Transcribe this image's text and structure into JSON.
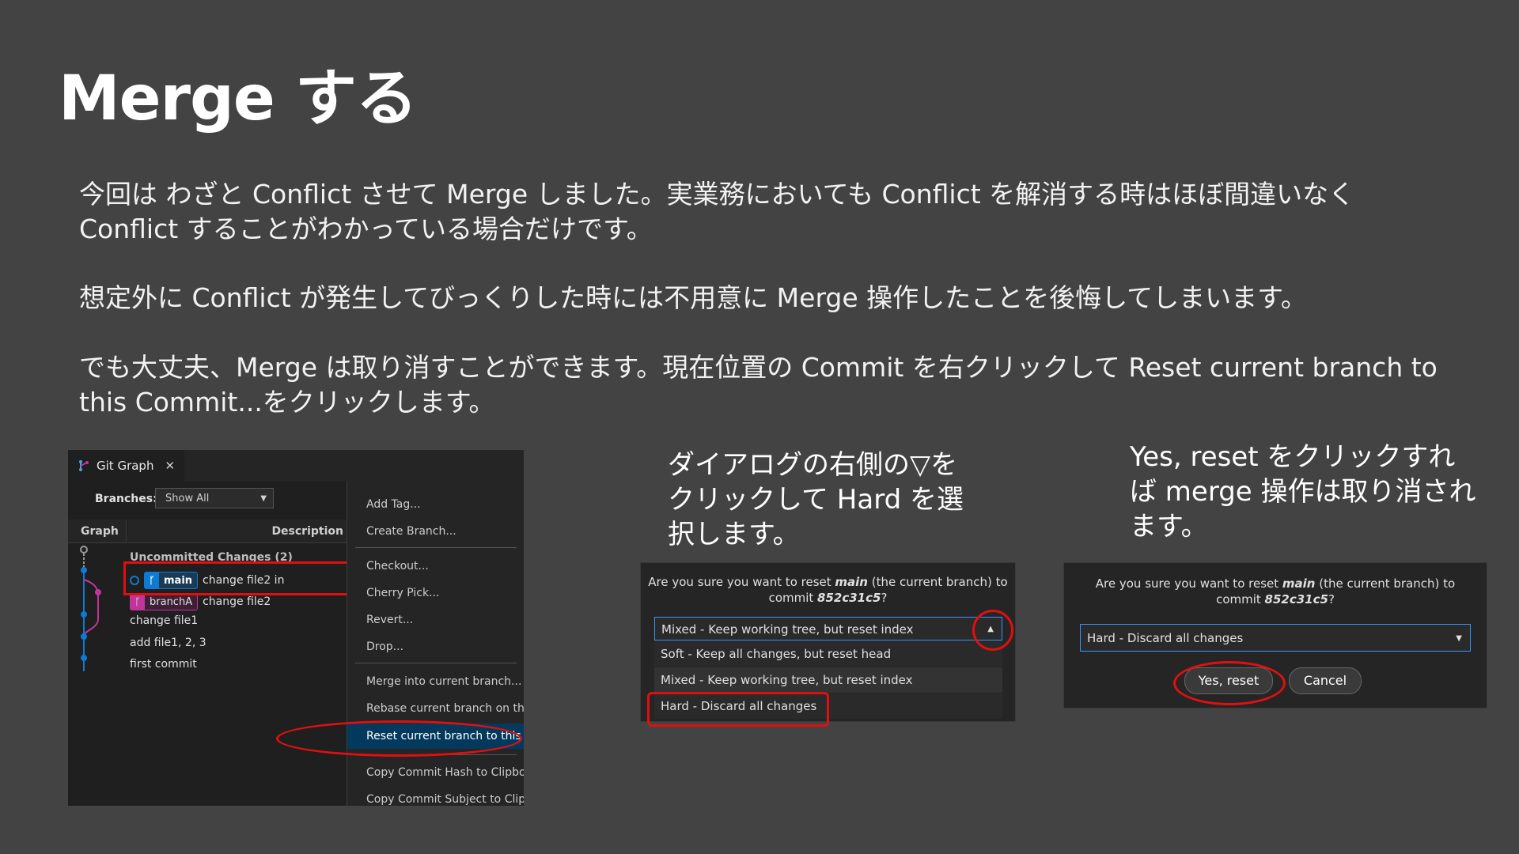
{
  "slide": {
    "title": "Merge する",
    "para1": "今回は わざと Conflict させて Merge しました。実業務においても Conflict を解消する時はほぼ間違いなく Conflict することがわかっている場合だけです。",
    "para2": "想定外に Conflict が発生してびっくりした時には不用意に Merge 操作したことを後悔してしまいます。",
    "para3": "でも大丈夫、Merge は取り消すことができます。現在位置の Commit を右クリックして Reset current branch to this Commit...をクリックします。"
  },
  "git_graph": {
    "tab_label": "Git Graph",
    "tab_close": "✕",
    "branches_label": "Branches:",
    "branches_select": "Show All",
    "col_graph": "Graph",
    "col_description": "Description",
    "uncommitted": "Uncommitted Changes (2)",
    "rows": [
      {
        "ref": "main",
        "text": "change file2 in"
      },
      {
        "ref": "branchA",
        "text": "change file2"
      },
      {
        "text": "change file1"
      },
      {
        "text": "add file1, 2, 3"
      },
      {
        "text": "first commit"
      }
    ],
    "context_menu": [
      "Add Tag...",
      "Create Branch...",
      "Checkout...",
      "Cherry Pick...",
      "Revert...",
      "Drop...",
      "Merge into current branch...",
      "Rebase current branch on this Commit...",
      "Reset current branch to this Commit...",
      "Copy Commit Hash to Clipboard",
      "Copy Commit Subject to Clipboard"
    ],
    "colors": {
      "main": "#0e7ad3",
      "branchA": "#c0359a",
      "highlight": "#e01010"
    }
  },
  "caption1": "ダイアログの右側の▽をクリックして Hard を選択します。",
  "caption2": "Yes, reset をクリックすれば merge 操作は取り消されます。",
  "dialog1": {
    "msg_line1_pre": "Are you sure you want to reset ",
    "branch": "main",
    "msg_line1_post": " (the current branch) to",
    "msg_line2_pre": "commit ",
    "commit": "852c31c5",
    "msg_line2_post": "?",
    "selected": "Mixed - Keep working tree, but reset index",
    "options": [
      "Soft - Keep all changes, but reset head",
      "Mixed - Keep working tree, but reset index",
      "Hard - Discard all changes"
    ]
  },
  "dialog2": {
    "msg_line1_pre": "Are you sure you want to reset ",
    "branch": "main",
    "msg_line1_post": " (the current branch) to",
    "msg_line2_pre": "commit ",
    "commit": "852c31c5",
    "msg_line2_post": "?",
    "selected": "Hard - Discard all changes",
    "yes_button": "Yes, reset",
    "cancel_button": "Cancel"
  }
}
